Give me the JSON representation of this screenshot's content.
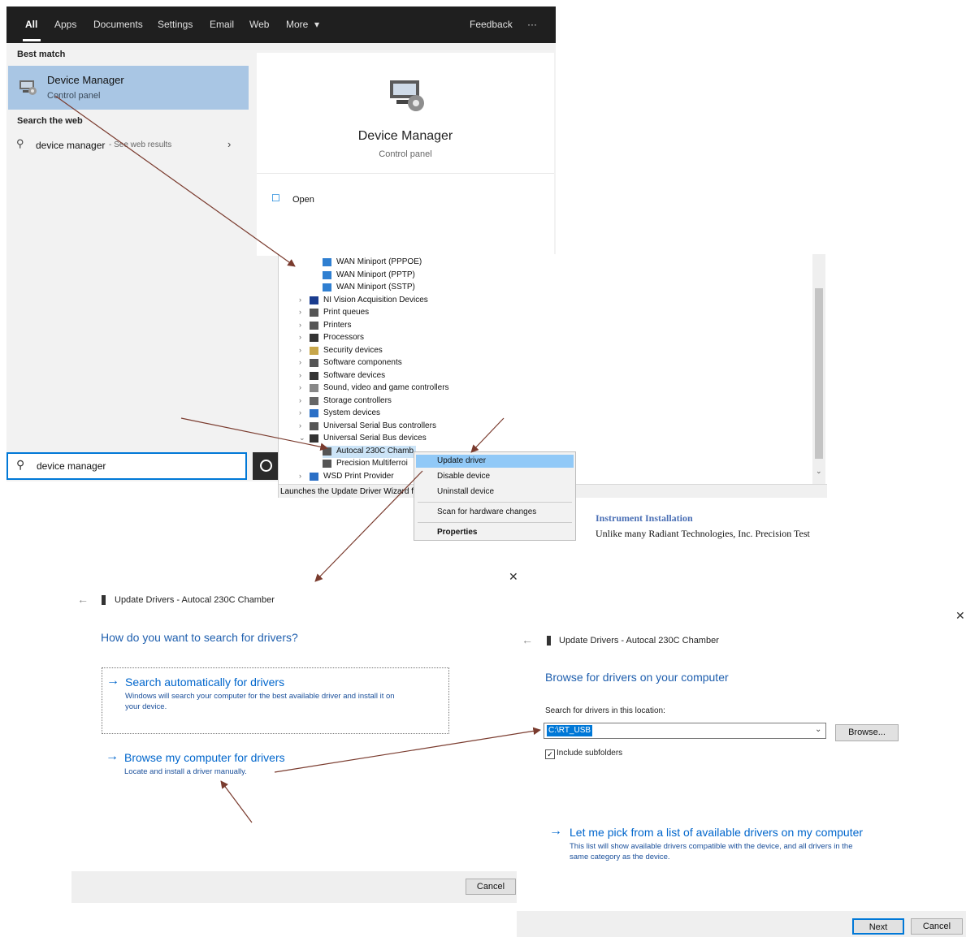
{
  "search": {
    "tabs": [
      "All",
      "Apps",
      "Documents",
      "Settings",
      "Email",
      "Web",
      "More"
    ],
    "feedback": "Feedback",
    "more_dots": "···",
    "best_match_heading": "Best match",
    "result_title": "Device Manager",
    "result_subtitle": "Control panel",
    "web_heading": "Search the web",
    "web_query": "device manager",
    "web_suffix": " - See web results",
    "preview_title": "Device Manager",
    "preview_subtitle": "Control panel",
    "open_label": "Open",
    "query": "device manager"
  },
  "device_manager": {
    "rows": [
      {
        "label": "WAN Miniport (PPPOE)",
        "chevron": false,
        "indent": true
      },
      {
        "label": "WAN Miniport (PPTP)",
        "chevron": false,
        "indent": true
      },
      {
        "label": "WAN Miniport (SSTP)",
        "chevron": false,
        "indent": true
      },
      {
        "label": "NI Vision Acquisition Devices",
        "chevron": true,
        "indent": false
      },
      {
        "label": "Print queues",
        "chevron": true,
        "indent": false
      },
      {
        "label": "Printers",
        "chevron": true,
        "indent": false
      },
      {
        "label": "Processors",
        "chevron": true,
        "indent": false
      },
      {
        "label": "Security devices",
        "chevron": true,
        "indent": false
      },
      {
        "label": "Software components",
        "chevron": true,
        "indent": false
      },
      {
        "label": "Software devices",
        "chevron": true,
        "indent": false
      },
      {
        "label": "Sound, video and game controllers",
        "chevron": true,
        "indent": false
      },
      {
        "label": "Storage controllers",
        "chevron": true,
        "indent": false
      },
      {
        "label": "System devices",
        "chevron": true,
        "indent": false
      },
      {
        "label": "Universal Serial Bus controllers",
        "chevron": true,
        "indent": false
      },
      {
        "label": "Universal Serial Bus devices",
        "chevron": true,
        "indent": false
      },
      {
        "label": "Autocal 230C Chamb",
        "chevron": false,
        "indent": true
      },
      {
        "label": "Precision Multiferroi",
        "chevron": false,
        "indent": true
      },
      {
        "label": "WSD Print Provider",
        "chevron": true,
        "indent": false
      }
    ],
    "status_text": "Launches the Update Driver Wizard f",
    "context_menu": [
      "Update driver",
      "Disable device",
      "Uninstall device",
      "Scan for hardware changes",
      "Properties"
    ]
  },
  "doc_snippet": {
    "heading": "Instrument Installation",
    "body": "Unlike many Radiant Technologies, Inc. Precision Test"
  },
  "dialog1": {
    "title": "Update Drivers - Autocal 230C Chamber",
    "question": "How do you want to search for drivers?",
    "option1_title": "Search automatically for drivers",
    "option1_desc_line1": "Windows will search your computer for the best available driver and install it on",
    "option1_desc_line2": "your device.",
    "option2_title": "Browse my computer for drivers",
    "option2_desc": "Locate and install a driver manually.",
    "cancel": "Cancel",
    "close": "✕"
  },
  "dialog2": {
    "title": "Update Drivers - Autocal 230C Chamber",
    "heading": "Browse for drivers on your computer",
    "location_label": "Search for drivers in this location:",
    "path_value": "C:\\RT_USB",
    "browse": "Browse...",
    "include_subfolders": "Include subfolders",
    "pick_title": "Let me pick from a list of available drivers on my computer",
    "pick_desc_line1": "This list will show available drivers compatible with the device, and all drivers in the",
    "pick_desc_line2": "same category as the device.",
    "next": "Next",
    "cancel": "Cancel",
    "close": "✕"
  },
  "colors": {
    "accent": "#0078d7",
    "link": "#0066cc",
    "annotation_arrow": "#7a3b2e",
    "selection": "#a9c6e4"
  }
}
